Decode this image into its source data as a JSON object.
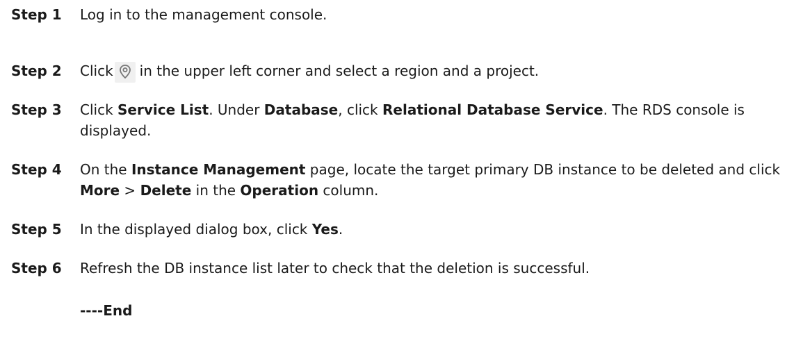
{
  "steps": [
    {
      "label": "Step 1",
      "text": "Log in to the management console."
    },
    {
      "label": "Step 2",
      "text_before_icon": "Click",
      "icon": "location-pin-icon",
      "text_after_icon": "in the upper left corner and select a region and a project."
    },
    {
      "label": "Step 3",
      "parts": [
        "Click ",
        "Service List",
        ". Under ",
        "Database",
        ", click ",
        "Relational Database Service",
        ". The RDS console is displayed."
      ]
    },
    {
      "label": "Step 4",
      "parts": [
        "On the ",
        "Instance Management",
        " page, locate the target primary DB instance to be deleted and click ",
        "More",
        " > ",
        "Delete",
        " in the ",
        "Operation",
        " column."
      ]
    },
    {
      "label": "Step 5",
      "parts": [
        "In the displayed dialog box, click ",
        "Yes",
        "."
      ]
    },
    {
      "label": "Step 6",
      "text": "Refresh the DB instance list later to check that the deletion is successful."
    }
  ],
  "end_marker": "----End",
  "colors": {
    "text": "#1a1a1a",
    "icon_stroke": "#777777",
    "icon_bg": "#f0f0f0"
  }
}
